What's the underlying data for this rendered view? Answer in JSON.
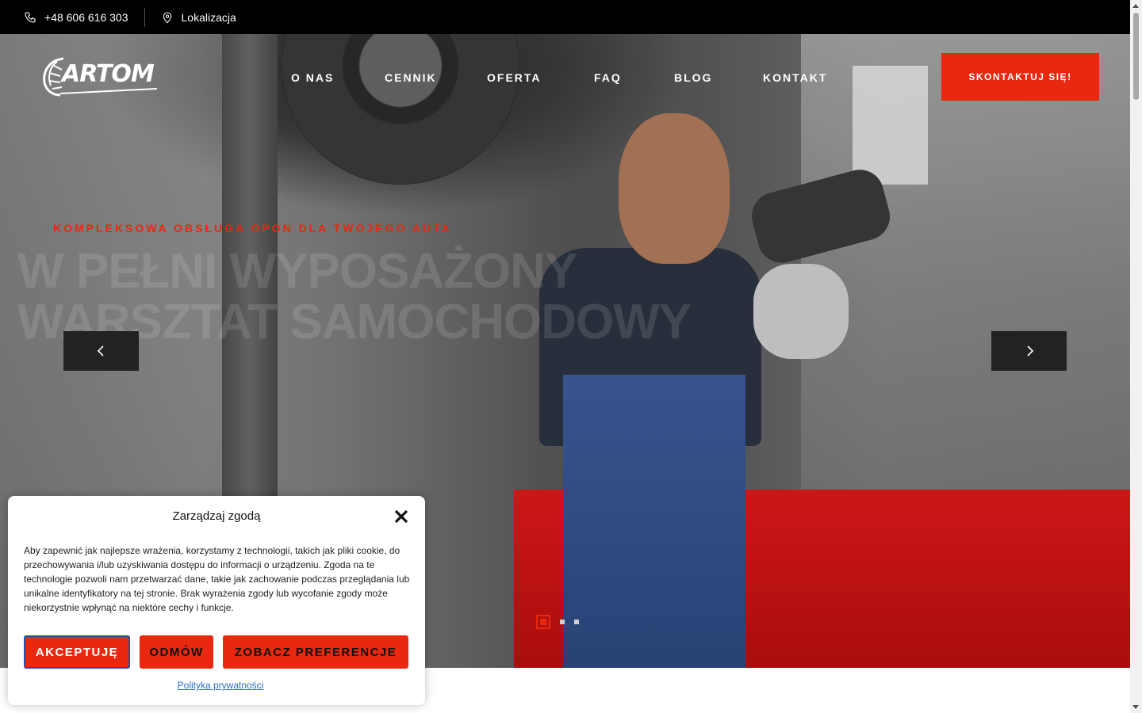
{
  "topbar": {
    "phone": "+48 606 616 303",
    "phone_icon": "phone-icon",
    "location": "Lokalizacja",
    "location_icon": "map-pin-icon"
  },
  "header": {
    "logo_text": "ARTOM",
    "nav": [
      "O NAS",
      "CENNIK",
      "OFERTA",
      "FAQ",
      "BLOG",
      "KONTAKT"
    ],
    "cta": "SKONTAKTUJ SIĘ!"
  },
  "hero": {
    "kicker": "KOMPLEKSOWA OBSŁUGA OPON DLA TWOJEGO AUTA",
    "headline_line1": "W PEŁNI WYPOSAŻONY",
    "headline_line2": "WARSZTAT SAMOCHODOWY",
    "prev_icon": "chevron-left-icon",
    "next_icon": "chevron-right-icon",
    "slides_total": 3,
    "active_slide": 1
  },
  "consent": {
    "title": "Zarządzaj zgodą",
    "body": "Aby zapewnić jak najlepsze wrażenia, korzystamy z technologii, takich jak pliki cookie, do przechowywania i/lub uzyskiwania dostępu do informacji o urządzeniu. Zgoda na te technologie pozwoli nam przetwarzać dane, takie jak zachowanie podczas przeglądania lub unikalne identyfikatory na tej stronie. Brak wyrażenia zgody lub wycofanie zgody może niekorzystnie wpłynąć na niektóre cechy i funkcje.",
    "accept": "AKCEPTUJĘ",
    "deny": "ODMÓW",
    "preferences": "ZOBACZ PREFERENCJE",
    "policy_link": "Polityka prywatności"
  },
  "colors": {
    "accent": "#e8280f",
    "topbar_bg": "#000000",
    "link": "#2b6cc4"
  }
}
